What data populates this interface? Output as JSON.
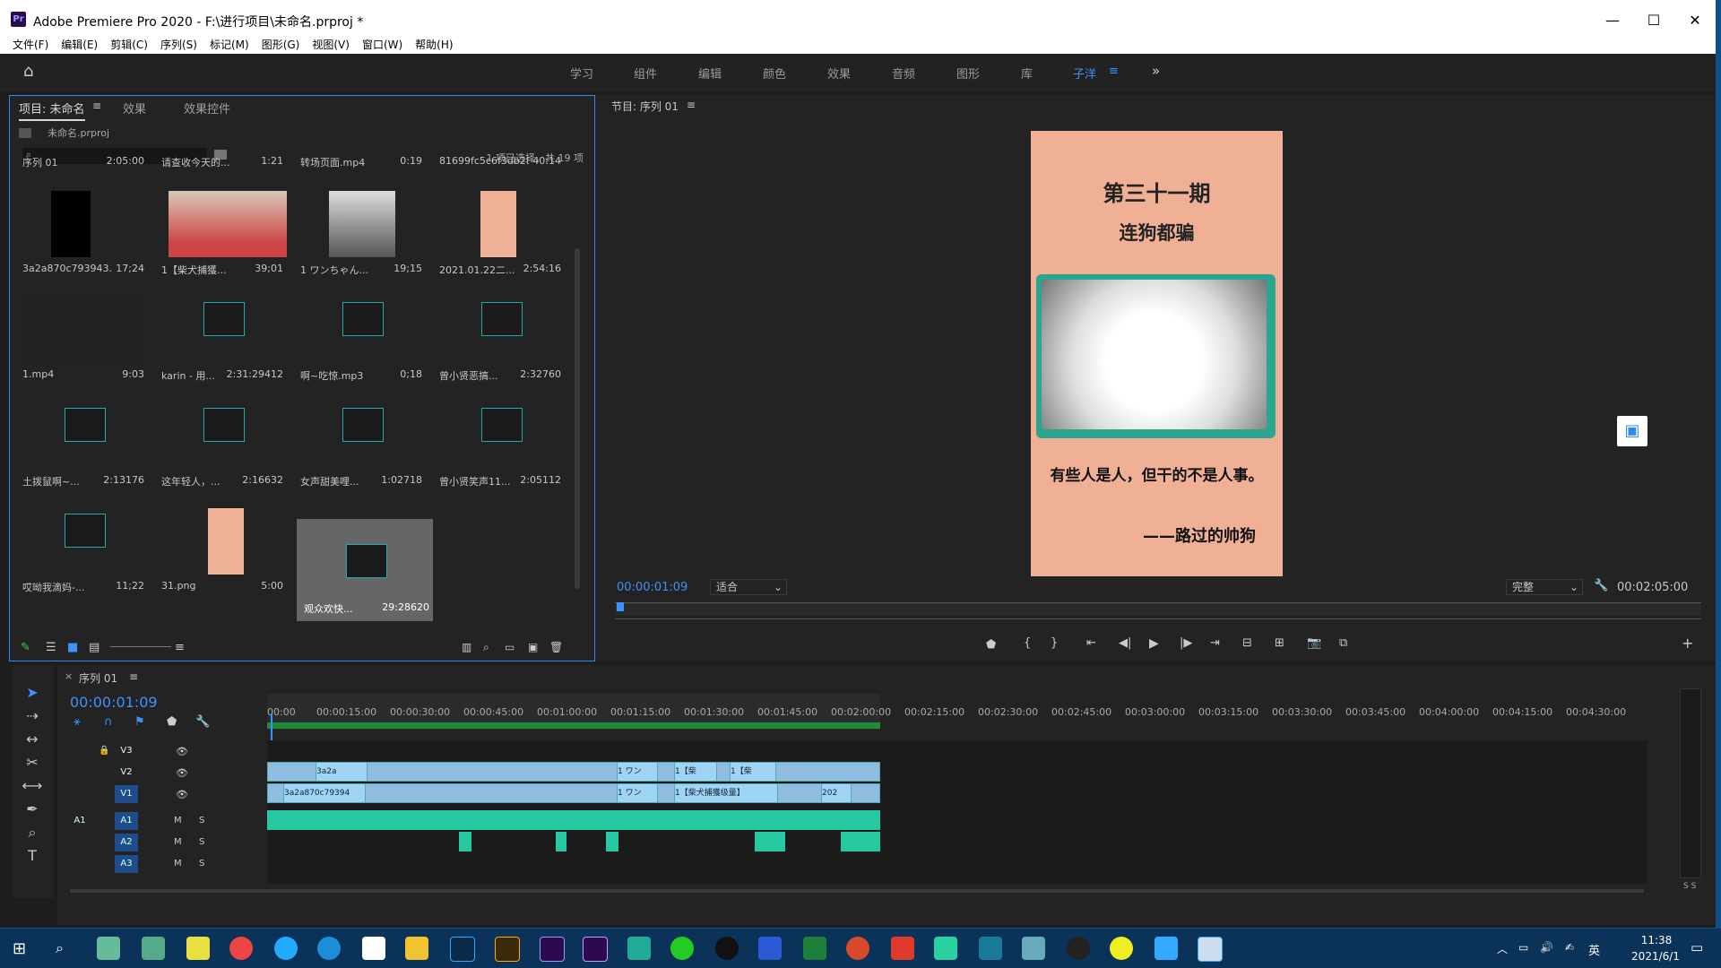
{
  "window": {
    "title": "Adobe Premiere Pro 2020 - F:\\进行项目\\未命名.prproj *",
    "min": "—",
    "max": "☐",
    "close": "✕"
  },
  "menu": [
    "文件(F)",
    "编辑(E)",
    "剪辑(C)",
    "序列(S)",
    "标记(M)",
    "图形(G)",
    "视图(V)",
    "窗口(W)",
    "帮助(H)"
  ],
  "workspaces": [
    "学习",
    "组件",
    "编辑",
    "颜色",
    "效果",
    "音频",
    "图形",
    "库",
    "子洋"
  ],
  "workspace_active": "子洋",
  "project": {
    "tabs": [
      "项目: 未命名",
      "效果",
      "效果控件"
    ],
    "file": "未命名.prproj",
    "selection_info": "1 项已选择，共 19 项",
    "items": [
      {
        "name": "序列 01",
        "dur": "2:05:00"
      },
      {
        "name": "请查收今天的...",
        "dur": "1:21"
      },
      {
        "name": "转场页面.mp4",
        "dur": "0:19"
      },
      {
        "name": "81699fc5c6f3db28...",
        "dur": "40:14"
      },
      {
        "name": "3a2a870c793943...",
        "dur": "17;24"
      },
      {
        "name": "1【柴犬捕獲...",
        "dur": "39;01"
      },
      {
        "name": "1 ワンちゃん...",
        "dur": "19;15"
      },
      {
        "name": "2021.01.22二...",
        "dur": "2:54:16"
      },
      {
        "name": "1.mp4",
        "dur": "9:03"
      },
      {
        "name": "karin - 用...",
        "dur": "2:31:29412"
      },
      {
        "name": "啊~吃惊.mp3",
        "dur": "0;18"
      },
      {
        "name": "曾小贤恶搞...",
        "dur": "2:32760"
      },
      {
        "name": "土拨鼠啊~...",
        "dur": "2:13176"
      },
      {
        "name": "这年轻人，...",
        "dur": "2:16632"
      },
      {
        "name": "女声甜美哩...",
        "dur": "1:02718"
      },
      {
        "name": "曾小贤笑声11...",
        "dur": "2:05112"
      },
      {
        "name": "哎呦我滴妈-...",
        "dur": "11;22"
      },
      {
        "name": "31.png",
        "dur": "5:00"
      },
      {
        "name": "观众欢快...",
        "dur": "29:28620"
      }
    ]
  },
  "program": {
    "title": "节目: 序列 01",
    "timecode": "00:00:01:09",
    "fit": "适合",
    "quality": "完整",
    "duration": "00:02:05:00",
    "frame": {
      "line1": "第三十一期",
      "line2": "连狗都骗",
      "caption": "有些人是人，但干的不是人事。",
      "sign": "——路过的帅狗"
    }
  },
  "timeline": {
    "sequence": "序列 01",
    "timecode": "00:00:01:09",
    "ruler": [
      "00:00",
      "00:00:15:00",
      "00:00:30:00",
      "00:00:45:00",
      "00:01:00:00",
      "00:01:15:00",
      "00:01:30:00",
      "00:01:45:00",
      "00:02:00:00",
      "00:02:15:00",
      "00:02:30:00",
      "00:02:45:00",
      "00:03:00:00",
      "00:03:15:00",
      "00:03:30:00",
      "00:03:45:00",
      "00:04:00:00",
      "00:04:15:00",
      "00:04:30:00"
    ],
    "tracks": {
      "v3": "V3",
      "v2": "V2",
      "v1": "V1",
      "a1": "A1",
      "a2": "A2",
      "a3": "A3",
      "a1src": "A1"
    },
    "clips": {
      "v2_c1": "3a2a",
      "v1_c1": "3a2a870c79394",
      "v1_c2": "1 ワン",
      "v1_c3": "1【柴犬捕獲级量】",
      "v1_c4": "202",
      "v2_c2": "1 ワン",
      "v2_c3": "1【柴",
      "v2_c4": "1【柴"
    },
    "track_m": "M",
    "track_s": "S"
  },
  "taskbar": {
    "time": "11:38",
    "date": "2021/6/1",
    "ime": "英"
  },
  "colors": {
    "accent": "#2d8ceb",
    "video_clip": "#9fd4f6",
    "audio_clip": "#27c9a2",
    "frame_bg": "#f0b095"
  }
}
